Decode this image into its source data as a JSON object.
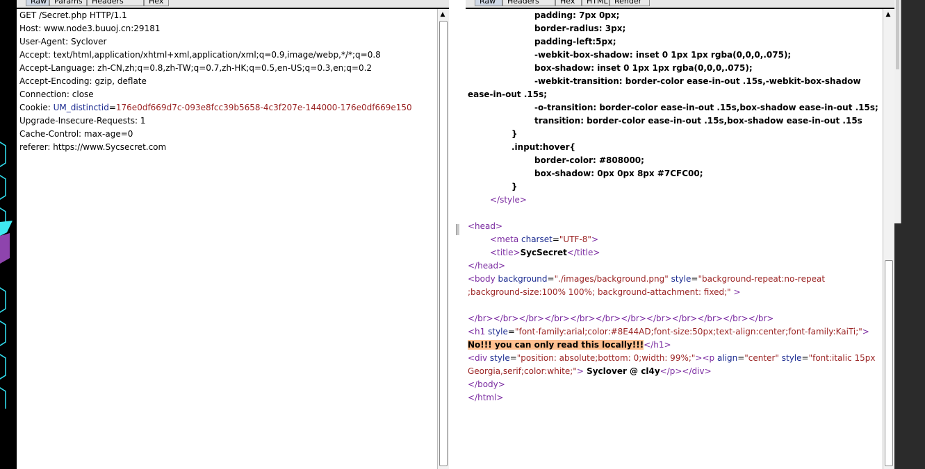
{
  "left_panel": {
    "tabs": [
      "Raw",
      "Params",
      "Headers",
      "Hex"
    ],
    "active_tab": "Raw",
    "request_lines": [
      "GET /Secret.php HTTP/1.1",
      "Host: www.node3.buuoj.cn:29181",
      "User-Agent: Syclover",
      "Accept: text/html,application/xhtml+xml,application/xml;q=0.9,image/webp,*/*;q=0.8",
      "Accept-Language: zh-CN,zh;q=0.8,zh-TW;q=0.7,zh-HK;q=0.5,en-US;q=0.3,en;q=0.2",
      "Accept-Encoding: gzip, deflate",
      "Connection: close"
    ],
    "cookie_label": "Cookie: ",
    "cookie_name": "UM_distinctid",
    "cookie_eq": "=",
    "cookie_value": "176e0df669d7c-093e8fcc39b5658-4c3f207e-144000-176e0df669e150",
    "after_cookie_lines": [
      "Upgrade-Insecure-Requests: 1",
      "Cache-Control: max-age=0",
      "referer: https://www.Sycsecret.com"
    ]
  },
  "right_panel": {
    "tabs": [
      "Raw",
      "Headers",
      "Hex",
      "HTML",
      "Render"
    ],
    "active_tab": "Raw",
    "css": {
      "l1": "padding: 7px 0px;",
      "l2": "border-radius: 3px;",
      "l3": "padding-left:5px;",
      "l4": "-webkit-box-shadow: inset 0 1px 1px rgba(0,0,0,.075);",
      "l5": "box-shadow: inset 0 1px 1px rgba(0,0,0,.075);",
      "l6": "-webkit-transition: border-color ease-in-out .15s,-webkit-box-shadow",
      "l7": "ease-in-out .15s;",
      "l8": "-o-transition: border-color ease-in-out .15s,box-shadow ease-in-out .15s;",
      "l9": "transition: border-color ease-in-out .15s,box-shadow ease-in-out .15s",
      "l10": "}",
      "l11": ".input:hover{",
      "l12": "border-color: #808000;",
      "l13": "box-shadow: 0px 0px 8px #7CFC00;",
      "l14": "}"
    },
    "style_close": "</style>",
    "head_open": "<head>",
    "meta_tag": "<meta",
    "meta_attr": " charset",
    "meta_eq": "=",
    "meta_val": "\"UTF-8\"",
    "meta_end": ">",
    "title_open": "<title>",
    "title_text": "SycSecret",
    "title_close": "</title>",
    "head_close": "</head>",
    "body_tag": "<body",
    "body_attr1": " background",
    "body_val1": "\"./images/background.png\"",
    "body_attr2": " style",
    "body_val2_a": "\"background-repeat:no-repeat",
    "body_val2_b": ";background-size:100% 100%; background-attachment: fixed;\"",
    "body_end": " >",
    "br_line": "</br></br></br></br></br></br></br></br></br></br></br></br>",
    "h1_tag": "<h1",
    "h1_attr": " style",
    "h1_val": "\"font-family:arial;color:#8E44AD;font-size:50px;text-align:center;font-family:KaiTi;\"",
    "h1_end": ">",
    "h1_text": "No!!! you can only read this locally!!!",
    "h1_close": "</h1>",
    "div_tag": "<div",
    "div_attr": " style",
    "div_val": "\"position: absolute;bottom: 0;width: 99%;\"",
    "div_end": ">",
    "p_tag": "<p",
    "p_attr1": " align",
    "p_val1": "\"center\"",
    "p_attr2": " style",
    "p_val2_a": "\"font:italic 15px",
    "p_val2_b": "Georgia,serif;color:white;\"",
    "p_end": ">",
    "p_text": " Syclover @ cl4y",
    "p_close": "</p>",
    "div_close": "</div>",
    "body_close": "</body>",
    "html_close": "</html>"
  }
}
